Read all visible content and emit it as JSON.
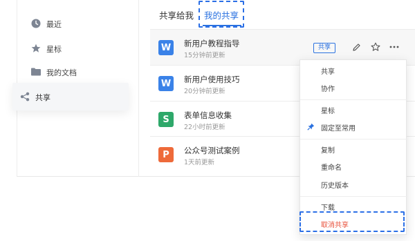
{
  "sidebar": {
    "items": [
      {
        "label": "最近",
        "icon": "clock-icon"
      },
      {
        "label": "星标",
        "icon": "star-icon"
      },
      {
        "label": "我的文档",
        "icon": "folder-icon"
      },
      {
        "label": "共享",
        "icon": "share-icon"
      }
    ]
  },
  "tabs": [
    {
      "label": "共享给我"
    },
    {
      "label": "我的共享"
    }
  ],
  "files": [
    {
      "name": "新用户教程指导",
      "time": "15分钟前更新",
      "icon_letter": "W",
      "color": "#3a82e8",
      "badge": "共享"
    },
    {
      "name": "新用户使用技巧",
      "time": "20分钟前更新",
      "icon_letter": "W",
      "color": "#3a82e8"
    },
    {
      "name": "表单信息收集",
      "time": "22小时前更新",
      "icon_letter": "S",
      "color": "#2ea86a"
    },
    {
      "name": "公众号测试案例",
      "time": "1天前更新",
      "icon_letter": "P",
      "color": "#ee6a3a"
    }
  ],
  "menu": {
    "items": [
      "共享",
      "协作",
      "星标",
      "固定至常用",
      "复制",
      "重命名",
      "历史版本",
      "下载",
      "取消共享"
    ]
  },
  "colors": {
    "accent": "#2b72e0",
    "danger": "#e8503a"
  }
}
